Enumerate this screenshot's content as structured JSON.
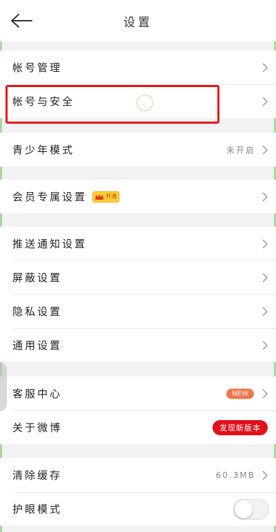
{
  "header": {
    "title": "设置",
    "back_icon": "arrow-left-icon"
  },
  "groups": [
    {
      "items": [
        {
          "label": "帐号管理"
        },
        {
          "label": "帐号与安全"
        }
      ]
    },
    {
      "items": [
        {
          "label": "青少年模式",
          "value": "未开启"
        }
      ]
    },
    {
      "items": [
        {
          "label": "会员专属设置",
          "badge": "开通"
        }
      ]
    },
    {
      "items": [
        {
          "label": "推送通知设置"
        },
        {
          "label": "屏蔽设置"
        },
        {
          "label": "隐私设置"
        },
        {
          "label": "通用设置"
        }
      ]
    },
    {
      "items": [
        {
          "label": "客服中心",
          "badge": "NEW"
        },
        {
          "label": "关于微博",
          "badge": "发现新版本"
        }
      ]
    },
    {
      "items": [
        {
          "label": "清除缓存",
          "value": "60.3MB"
        },
        {
          "label": "护眼模式",
          "toggle": false
        }
      ]
    }
  ],
  "colors": {
    "highlight": "#e81313",
    "new_badge": "#f3754a",
    "version_badge": "#e0101c"
  }
}
